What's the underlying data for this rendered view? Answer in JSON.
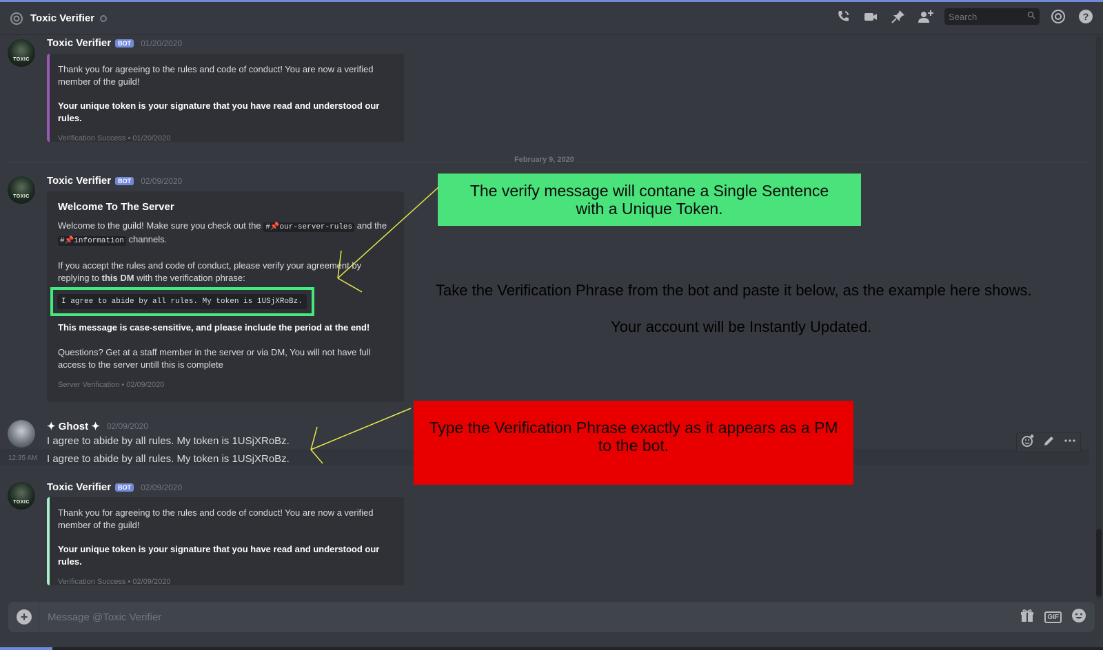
{
  "colors": {
    "accent": "#7289da",
    "annotation_green": "#4ae27a",
    "annotation_red": "#e80000",
    "annotation_arrow": "#e8e84a",
    "highlight_border": "#43e97b"
  },
  "header": {
    "title": "Toxic Verifier",
    "icons": [
      "at-icon",
      "status-icon",
      "call-icon",
      "video-icon",
      "pin-icon",
      "add-friend-icon",
      "mention-icon",
      "help-icon"
    ],
    "search_placeholder": "Search"
  },
  "messages": [
    {
      "author": "Toxic Verifier",
      "bot_badge": "BOT",
      "timestamp": "01/20/2020",
      "avatar_text": "TOXIC",
      "embed": {
        "color": "#9b59b6",
        "body": "Thank you for agreeing to the rules and code of conduct! You are now a verified member of the guild!",
        "bold": "Your unique token is your signature that you have read and understood our rules.",
        "footer_label": "Verification Success",
        "footer_date": "01/20/2020"
      }
    },
    {
      "author": "Toxic Verifier",
      "bot_badge": "BOT",
      "timestamp": "02/09/2020",
      "avatar_text": "TOXIC",
      "embed": {
        "color": "#2f3136",
        "title": "Welcome To The Server",
        "line1_pre": "Welcome to the guild! Make sure you check out the",
        "channel1": "#📌our-server-rules",
        "line1_mid": "and the",
        "channel2": "#📌information",
        "line1_post": "channels.",
        "line2_pre": "If you accept the rules and code of conduct, please verify your agreement by replying to",
        "line2_bold": "this DM",
        "line2_post": "with the verification phrase:",
        "phrase": "I agree to abide by all rules. My token is 1USjXRoBz.",
        "case_note": "This message is case-sensitive, and please include the period at the end!",
        "questions": "Questions? Get at a staff member in the server or via DM, You will not have full access to the server untill this is complete",
        "footer_label": "Server Verification",
        "footer_date": "02/09/2020"
      }
    },
    {
      "author": "✦ Ghost ✦",
      "timestamp": "02/09/2020",
      "lines": [
        "I  agree to abide by all rules. My token is 1USjXRoBz.",
        "I agree to abide by all rules. My token is 1USjXRoBz."
      ],
      "side_time": "12:35 AM"
    },
    {
      "author": "Toxic Verifier",
      "bot_badge": "BOT",
      "timestamp": "02/09/2020",
      "avatar_text": "TOXIC",
      "embed": {
        "color": "#a8f0c8",
        "body": "Thank you for agreeing to the rules and code of conduct! You are now a verified member of the guild!",
        "bold": "Your unique token is your signature that you have read and understood our rules.",
        "footer_label": "Verification Success",
        "footer_date": "02/09/2020"
      }
    }
  ],
  "divider_label": "February 9, 2020",
  "annotations": {
    "green_box": "The verify message will contane a Single Sentence with a Unique Token.",
    "instruction1": "Take the Verification Phrase from the bot and paste it below, as the example here shows.",
    "instruction2": "Your account will be Instantly Updated.",
    "red_box": "Type the Verification Phrase exactly as it appears as a PM to the bot."
  },
  "composer": {
    "placeholder": "Message @Toxic Verifier",
    "gif_label": "GIF"
  },
  "footer_separator": "•"
}
